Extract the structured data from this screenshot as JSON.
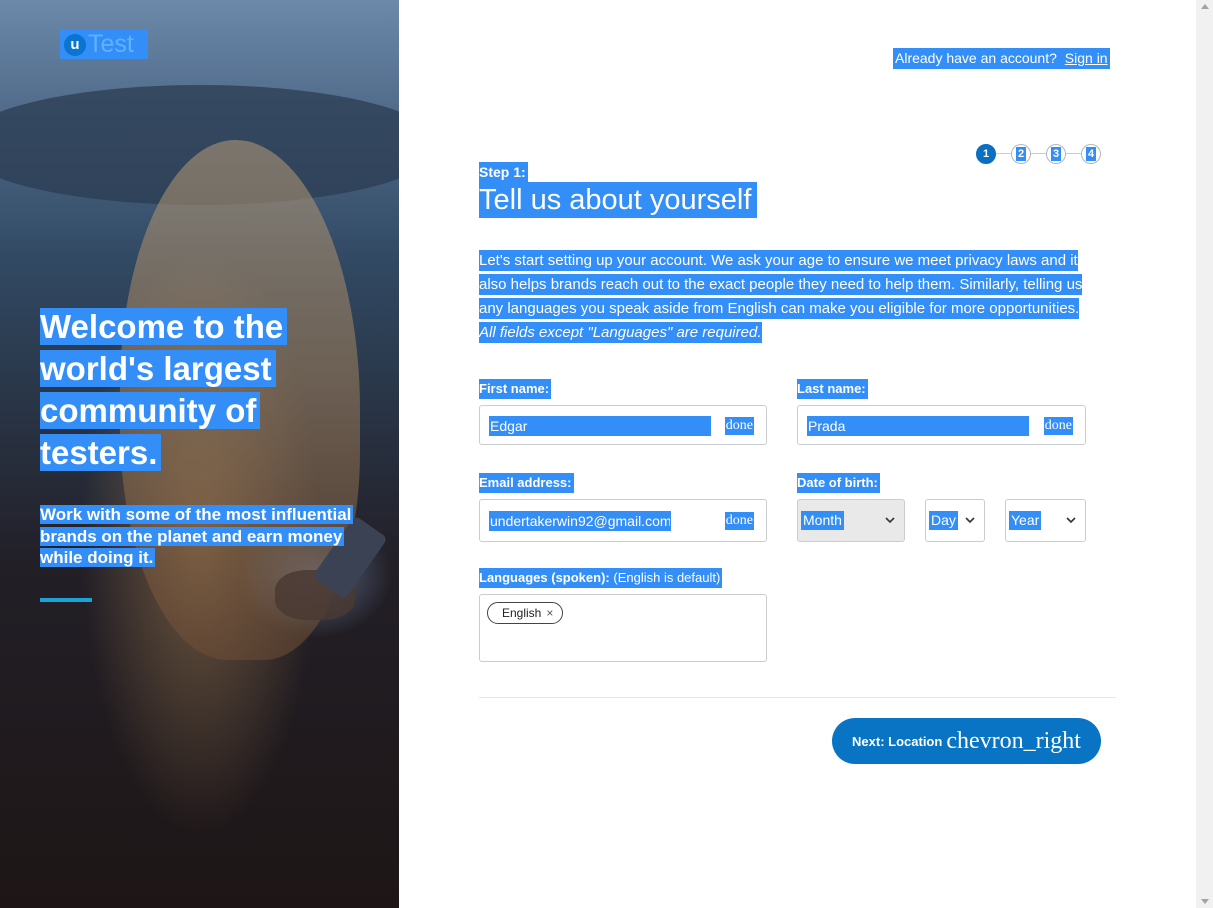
{
  "brand": {
    "logo_u": "u",
    "logo_text": "Test"
  },
  "hero": {
    "title": "Welcome to the world's largest community of testers.",
    "subtitle": "Work with some of the most influential brands on the planet and earn money while doing it."
  },
  "header": {
    "account_prompt": "Already have an account?",
    "signin_link": "Sign in"
  },
  "stepper": {
    "steps": [
      "1",
      "2",
      "3",
      "4"
    ],
    "current": 1
  },
  "form": {
    "step_label": "Step 1:",
    "title": "Tell us about yourself",
    "intro": "Let's start setting up your account. We ask your age to ensure we meet privacy laws and it also helps brands reach out to the exact people they need to help them. Similarly, telling us any languages you speak aside from English can make you eligible for more opportunities.",
    "intro_note": "All fields except \"Languages\" are required.",
    "first_name": {
      "label": "First name:",
      "value": "Edgar",
      "status": "done"
    },
    "last_name": {
      "label": "Last name:",
      "value": "Prada",
      "status": "done"
    },
    "email": {
      "label": "Email address:",
      "value": "undertakerwin92@gmail.com",
      "status": "done"
    },
    "dob": {
      "label": "Date of birth:",
      "month": "Month",
      "day": "Day",
      "year": "Year"
    },
    "languages": {
      "label": "Languages (spoken):",
      "hint": "(English is default)",
      "chips": [
        "English"
      ],
      "remove_glyph": "×"
    },
    "next_button": {
      "label": "Next: Location",
      "icon": "chevron_right"
    }
  },
  "colors": {
    "primary": "#0a74c4",
    "selection": "#338ef7",
    "accent_bar": "#1ba2d8"
  }
}
